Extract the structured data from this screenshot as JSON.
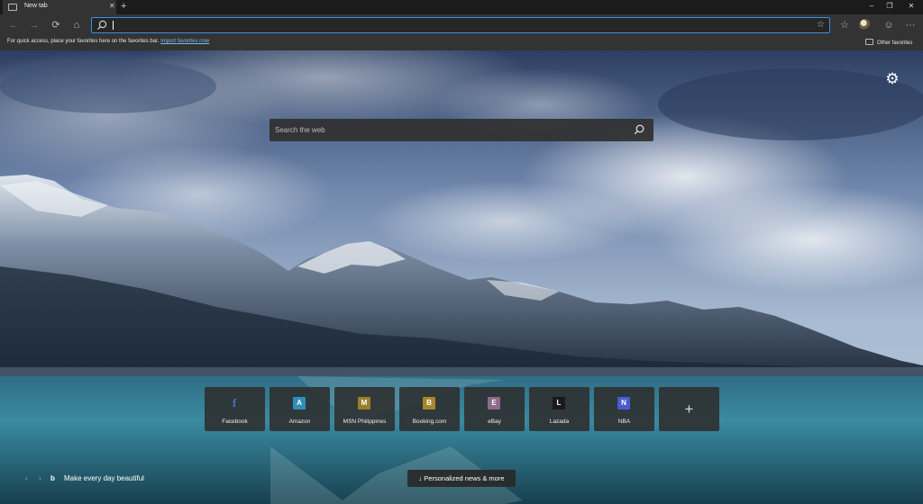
{
  "tabs": [
    {
      "title": "New tab"
    }
  ],
  "tab_controls": {
    "close": "✕",
    "new": "+"
  },
  "window_controls": {
    "minimize": "–",
    "maximize": "❐",
    "close": "✕"
  },
  "toolbar": {
    "back": "←",
    "forward": "→",
    "refresh": "⟳",
    "home": "⌂",
    "address_value": "",
    "favorite_star": "☆",
    "favorites_hub": "☆",
    "emoji": "☺",
    "more": "···"
  },
  "favorites_bar": {
    "message": "For quick access, place your favorites here on the favorites bar.",
    "import_link": "Import favorites now",
    "other_favorites": "Other favorites"
  },
  "search": {
    "placeholder": "Search the web"
  },
  "quick_links": [
    {
      "label": "Facebook",
      "letter": "f",
      "color": "transparent"
    },
    {
      "label": "Amazon",
      "letter": "A",
      "color": "#2e8fb8"
    },
    {
      "label": "MSN Philippines",
      "letter": "M",
      "color": "#9a7f2a"
    },
    {
      "label": "Booking.com",
      "letter": "B",
      "color": "#a8862a"
    },
    {
      "label": "eBay",
      "letter": "E",
      "color": "#8f6a8a"
    },
    {
      "label": "Lazada",
      "letter": "L",
      "color": "#1a1a1a"
    },
    {
      "label": "NBA",
      "letter": "N",
      "color": "#4a5bd0"
    }
  ],
  "add_link": "+",
  "footer": {
    "prev": "‹",
    "next": "›",
    "bing_logo": "b",
    "tagline": "Make every day beautiful",
    "news_button": "↓  Personalized news & more"
  },
  "icons": {
    "settings": "⚙"
  }
}
